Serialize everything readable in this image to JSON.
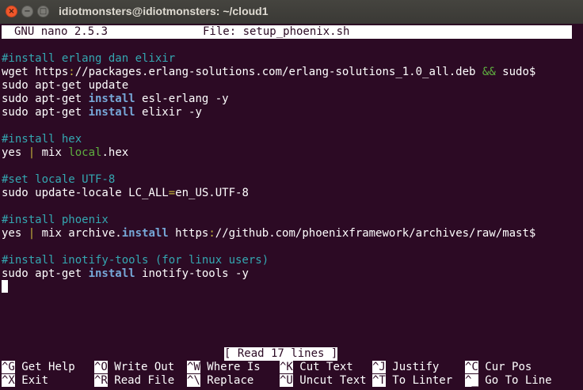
{
  "window": {
    "title": "idiotmonsters@idiotmonsters: ~/cloud1"
  },
  "nano": {
    "version": "GNU nano 2.5.3",
    "file": "File: setup_phoenix.sh"
  },
  "lines": {
    "l1": {
      "a": "#install erlang dan elixir"
    },
    "l2": {
      "a": "wget https",
      "b": ":",
      "c": "//packages.erlang-solutions.com/erlang-solutions_1.0_all.deb ",
      "d": "&&",
      "e": " sudo$"
    },
    "l3": {
      "a": "sudo apt-get update"
    },
    "l4": {
      "a": "sudo apt-get ",
      "b": "install",
      "c": " esl-erlang -y"
    },
    "l5": {
      "a": "sudo apt-get ",
      "b": "install",
      "c": " elixir -y"
    },
    "l7": {
      "a": "#install hex"
    },
    "l8": {
      "a": "yes ",
      "b": "|",
      "c": " mix ",
      "d": "local",
      "e": ".hex"
    },
    "l10": {
      "a": "#set locale UTF-8"
    },
    "l11": {
      "a": "sudo update-locale LC_ALL",
      "b": "=",
      "c": "en_US.UTF-8"
    },
    "l13": {
      "a": "#install phoenix"
    },
    "l14": {
      "a": "yes ",
      "b": "|",
      "c": " mix archive.",
      "d": "install",
      "e": " https",
      "f": ":",
      "g": "//github.com/phoenixframework/archives/raw/mast$"
    },
    "l16": {
      "a": "#install inotify-tools (for linux users)"
    },
    "l17": {
      "a": "sudo apt-get ",
      "b": "install",
      "c": " inotify-tools -y"
    }
  },
  "status": "[ Read 17 lines ]",
  "shortcuts": [
    {
      "key": "^G",
      "label": "Get Help"
    },
    {
      "key": "^O",
      "label": "Write Out"
    },
    {
      "key": "^W",
      "label": "Where Is"
    },
    {
      "key": "^K",
      "label": "Cut Text"
    },
    {
      "key": "^J",
      "label": "Justify"
    },
    {
      "key": "^C",
      "label": "Cur Pos"
    },
    {
      "key": "^X",
      "label": "Exit"
    },
    {
      "key": "^R",
      "label": "Read File"
    },
    {
      "key": "^\\",
      "label": "Replace"
    },
    {
      "key": "^U",
      "label": "Uncut Text"
    },
    {
      "key": "^T",
      "label": "To Linter"
    },
    {
      "key": "^_",
      "label": "Go To Line"
    }
  ]
}
